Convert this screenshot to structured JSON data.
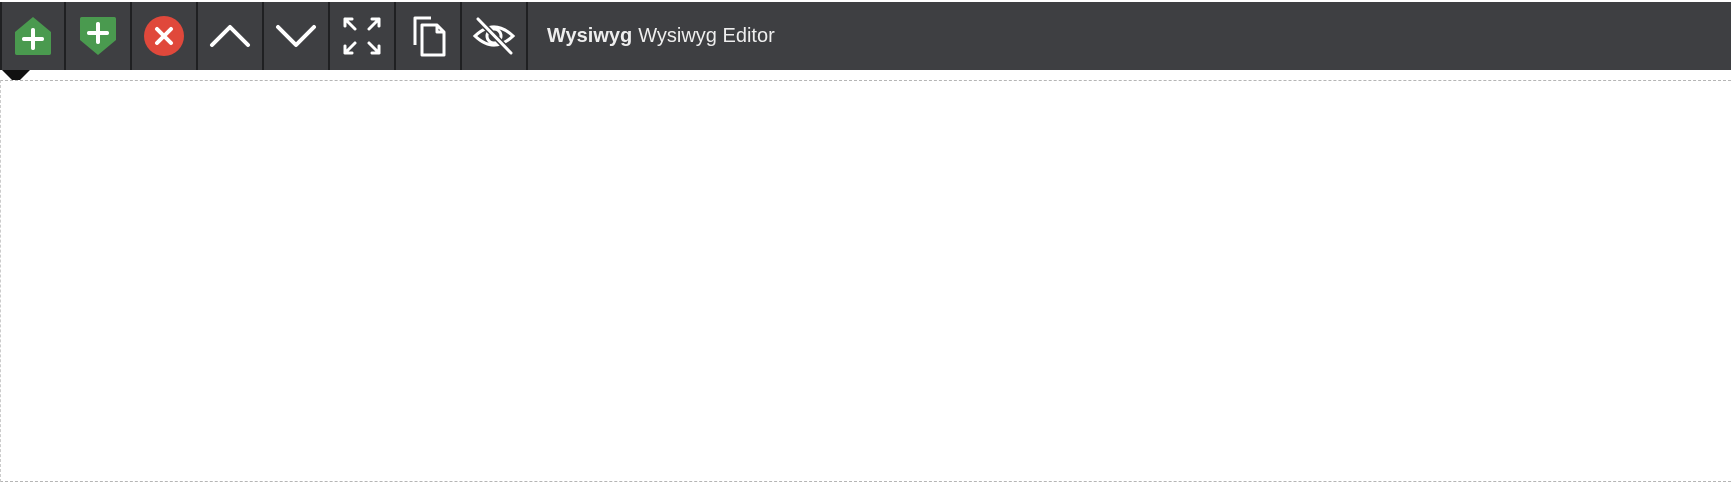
{
  "toolbar": {
    "buttons": [
      {
        "name": "add-above-button",
        "icon": "add-up-arrow-icon",
        "color": "#4a9a4f"
      },
      {
        "name": "add-below-button",
        "icon": "add-down-arrow-icon",
        "color": "#4a9a4f"
      },
      {
        "name": "remove-button",
        "icon": "close-circle-icon",
        "color": "#e0483b"
      },
      {
        "name": "move-up-button",
        "icon": "chevron-up-icon",
        "color": "#ffffff"
      },
      {
        "name": "move-down-button",
        "icon": "chevron-down-icon",
        "color": "#ffffff"
      },
      {
        "name": "expand-button",
        "icon": "expand-icon",
        "color": "#ffffff"
      },
      {
        "name": "copy-button",
        "icon": "copy-icon",
        "color": "#ffffff"
      },
      {
        "name": "hide-button",
        "icon": "eye-slash-icon",
        "color": "#ffffff"
      }
    ],
    "title_type": "Wysiwyg",
    "title_label": "Wysiwyg Editor",
    "background": "#3e3f42"
  },
  "editor": {
    "content": ""
  }
}
